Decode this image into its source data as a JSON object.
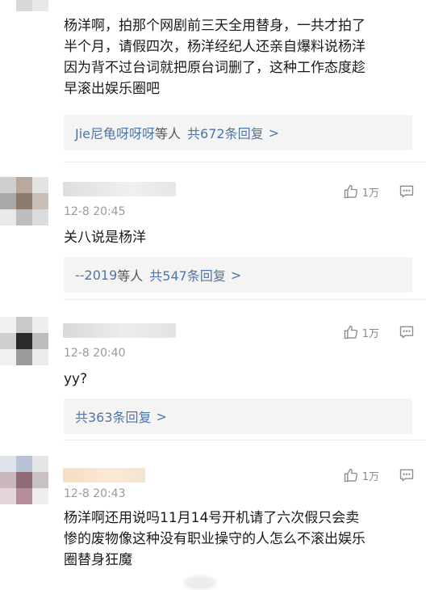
{
  "comments": [
    {
      "time": "",
      "text": "杨洋啊，拍那个网剧前三天全用替身，一共才拍了\n半个月，请假四次，杨洋经纪人还亲自爆料说杨洋\n因为背不过台词就把原台词删了，这种工作态度趁\n早滚出娱乐圈吧",
      "reply_user": "Jie尼龟呀呀呀",
      "reply_others": "等人",
      "reply_count": "共672条回复",
      "chevron": ">"
    },
    {
      "time": "12-8 20:45",
      "likes": "1万",
      "text": "关八说是杨洋",
      "reply_user": "--2019",
      "reply_others": "等人",
      "reply_count": "共547条回复",
      "chevron": ">"
    },
    {
      "time": "12-8 20:40",
      "likes": "1万",
      "text": "yy?",
      "reply_count": "共363条回复",
      "chevron": ">"
    },
    {
      "time": "12-8 20:43",
      "likes": "1万",
      "text": "杨洋啊还用说吗11月14号开机请了六次假只会卖\n惨的废物像这种没有职业操守的人怎么不滚出娱乐\n圈替身狂魔 "
    }
  ],
  "icons": {
    "like": "thumbs-up-icon",
    "reply": "comment-icon"
  },
  "colors": {
    "link": "#4f74a8",
    "meta": "#9a9a9a",
    "reply_bg": "#f4f4f4"
  }
}
